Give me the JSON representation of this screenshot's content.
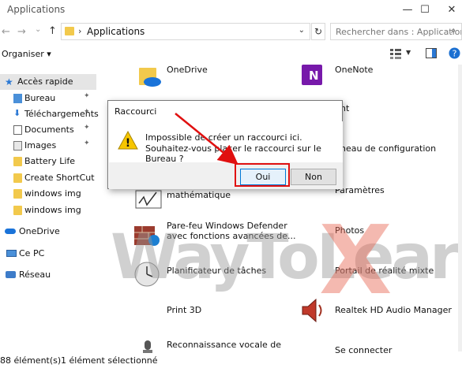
{
  "window": {
    "title": "Applications",
    "minimize": "—",
    "maximize": "☐",
    "close": "✕"
  },
  "address": {
    "path": "Applications",
    "separator": "›",
    "dropdown": "⌄",
    "refresh": "↻",
    "search_placeholder": "Rechercher dans : Applications"
  },
  "nav": {
    "back": "←",
    "forward": "→",
    "recent": "⌄",
    "up": "↑"
  },
  "toolbar": {
    "organiser": "Organiser ▾"
  },
  "sidebar": {
    "items": [
      {
        "label": "Accès rapide",
        "pinned": false
      },
      {
        "label": "Bureau",
        "pinned": true
      },
      {
        "label": "Téléchargements",
        "pinned": true
      },
      {
        "label": "Documents",
        "pinned": true
      },
      {
        "label": "Images",
        "pinned": true
      },
      {
        "label": "Battery Life",
        "pinned": false
      },
      {
        "label": "Create ShortCut",
        "pinned": false
      },
      {
        "label": "windows img",
        "pinned": false
      },
      {
        "label": "windows img",
        "pinned": false
      },
      {
        "label": "OneDrive",
        "pinned": false
      },
      {
        "label": "Ce PC",
        "pinned": false
      },
      {
        "label": "Réseau",
        "pinned": false
      }
    ],
    "pin_glyph": "📌"
  },
  "apps": {
    "onedrive": "OneDrive",
    "onenote": "OneNote",
    "paint": "int",
    "panneau": "nneau de configuration",
    "parametres": "Paramètres",
    "math1": "mathématique",
    "parefeu1": "Pare-feu Windows Defender",
    "parefeu2": "avec fonctions avancées de...",
    "photos": "Photos",
    "planificateur": "Planificateur de tâches",
    "portail": "Portail de réalité mixte",
    "print3d": "Print 3D",
    "realtek": "Realtek HD Audio Manager",
    "reconnaissance": "Reconnaissance vocale de",
    "seconnecter": "Se connecter"
  },
  "watermark": {
    "text": "WayToLearn",
    "x": "X"
  },
  "status": {
    "count": "88 élément(s)",
    "selected": "1 élément sélectionné"
  },
  "dialog": {
    "title": "Raccourci",
    "line1": "Impossible de créer un raccourci ici.",
    "line2": "Souhaitez-vous placer le raccourci sur le Bureau ?",
    "yes": "Oui",
    "no": "Non",
    "warn_glyph": "!"
  },
  "colors": {
    "accent": "#0078d7",
    "highlight_red": "#e01010",
    "folder_yellow": "#f2c94c"
  }
}
